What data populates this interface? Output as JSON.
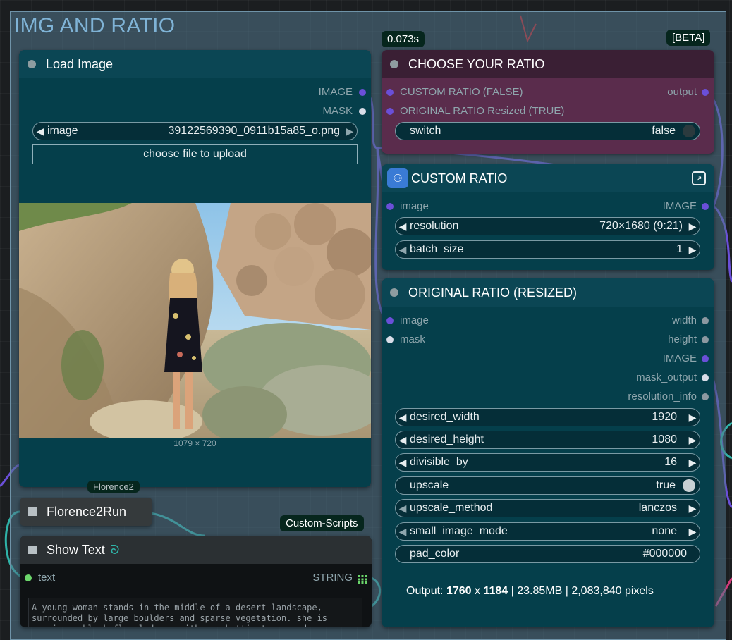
{
  "group": {
    "title": "IMG AND RATIO"
  },
  "badges": {
    "time": "0.073s",
    "beta": "[BETA]",
    "custom_scripts": "Custom-Scripts",
    "florence_tag": "Florence2"
  },
  "load_image": {
    "title": "Load Image",
    "outputs": [
      "IMAGE",
      "MASK"
    ],
    "image_widget": {
      "label": "image",
      "value": "39122569390_0911b15a85_o.png"
    },
    "upload_button": "choose file to upload",
    "dimensions": "1079 × 720"
  },
  "choose_ratio": {
    "title": "CHOOSE YOUR RATIO",
    "inputs": [
      "CUSTOM RATIO (FALSE)",
      "ORIGINAL RATIO Resized (TRUE)"
    ],
    "output": "output",
    "switch": {
      "label": "switch",
      "value": "false"
    }
  },
  "custom_ratio": {
    "title": "CUSTOM RATIO",
    "input": "image",
    "output": "IMAGE",
    "resolution": {
      "label": "resolution",
      "value": "720×1680 (9:21)"
    },
    "batch_size": {
      "label": "batch_size",
      "value": "1"
    }
  },
  "original_ratio": {
    "title": "ORIGINAL RATIO (RESIZED)",
    "inputs": [
      "image",
      "mask"
    ],
    "outputs": [
      "width",
      "height",
      "IMAGE",
      "mask_output",
      "resolution_info"
    ],
    "widgets": [
      {
        "label": "desired_width",
        "value": "1920"
      },
      {
        "label": "desired_height",
        "value": "1080"
      },
      {
        "label": "divisible_by",
        "value": "16"
      },
      {
        "label": "upscale",
        "value": "true"
      },
      {
        "label": "upscale_method",
        "value": "lanczos"
      },
      {
        "label": "small_image_mode",
        "value": "none"
      },
      {
        "label": "pad_color",
        "value": "#000000"
      }
    ],
    "output_info": {
      "prefix": "Output:",
      "w": "1760",
      "x": "x",
      "h": "1184",
      "sep1": "|",
      "size": "23.85MB",
      "sep2": "|",
      "pixels": "2,083,840 pixels"
    }
  },
  "florence_run": {
    "title": "Florence2Run"
  },
  "show_text": {
    "title": "Show Text",
    "input": "text",
    "output": "STRING",
    "content": "A young woman stands in the middle of a desert landscape, surrounded by large boulders and sparse vegetation. she is wearing a black floral dress with spaghetti straps and a"
  },
  "colors": {
    "accent_purple": "#6a4fd8",
    "node_bg": "#053f4b",
    "header_ratio": "#3a1f34",
    "link_teal": "#2fb3a8"
  }
}
